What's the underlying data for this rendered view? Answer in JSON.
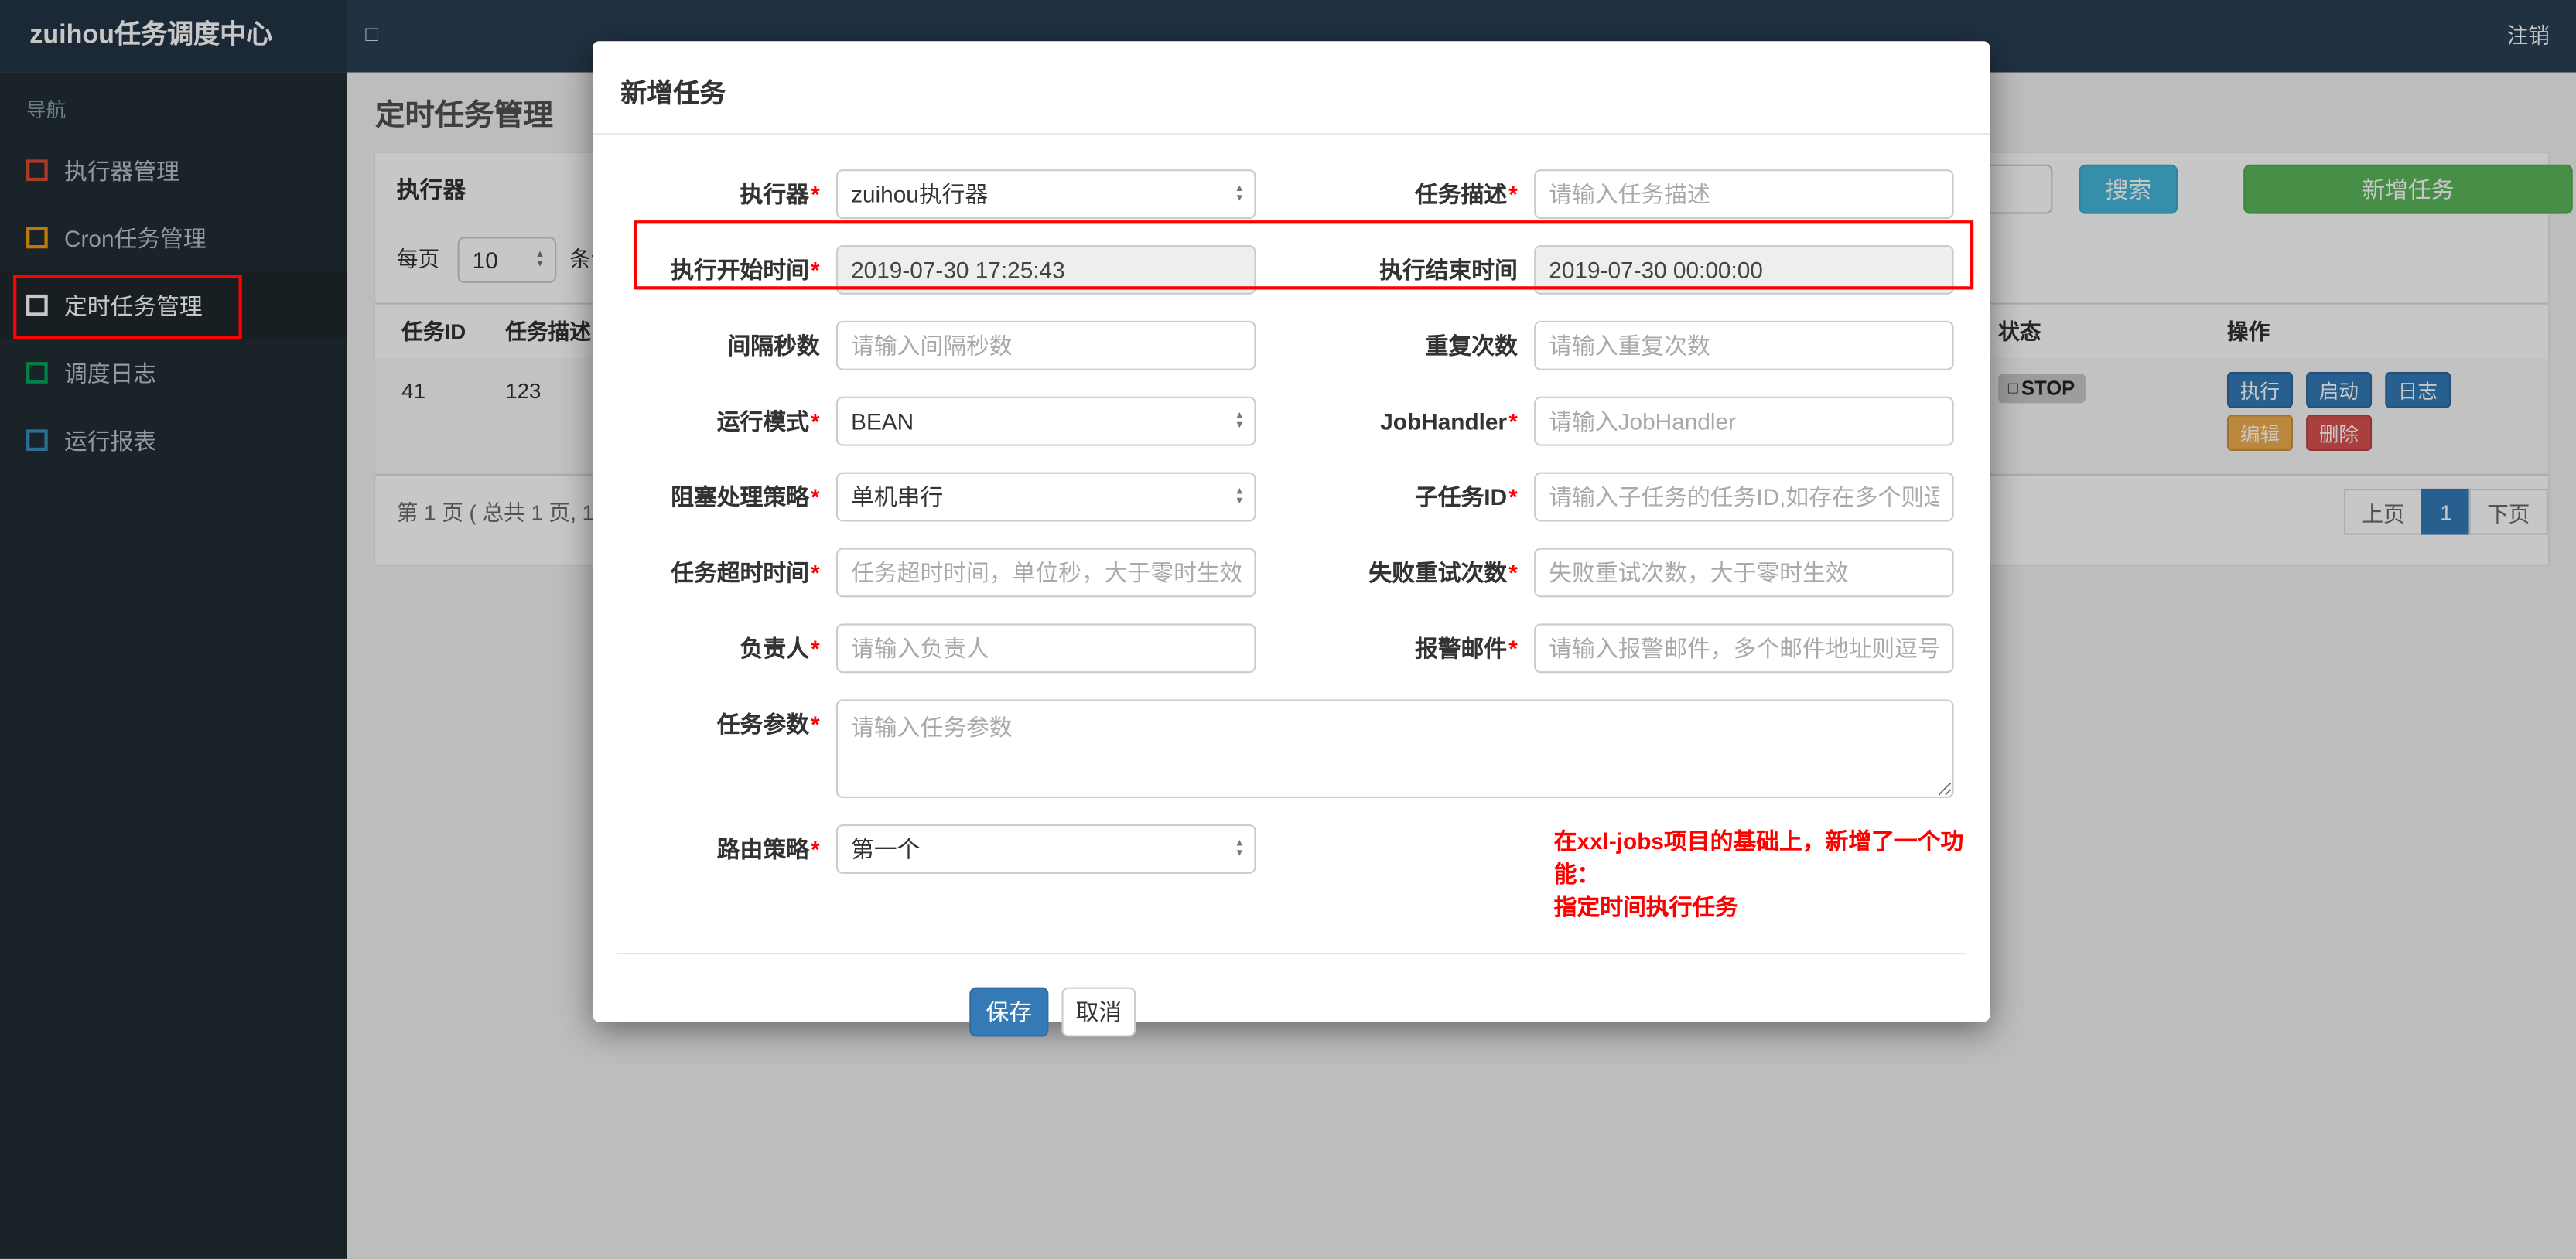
{
  "colors": {
    "topbar_bg": "#2a3f54",
    "sidebar_bg": "#222d32",
    "primary": "#337ab7",
    "success": "#5cb85c",
    "info": "#46b8da",
    "warning": "#f0ad4e",
    "danger": "#d9534f",
    "annotation": "#ff0000"
  },
  "icons": {
    "caret_up": "▲",
    "caret_down": "▼",
    "square": "□"
  },
  "topbar": {
    "brand": "zuihou任务调度中心",
    "toggle_icon": "□",
    "logout": "注销"
  },
  "sidebar": {
    "header": "导航",
    "items": [
      {
        "label": "执行器管理",
        "color": "#dd4b39"
      },
      {
        "label": "Cron任务管理",
        "color": "#f39c12"
      },
      {
        "label": "定时任务管理",
        "color": "#ffffff"
      },
      {
        "label": "调度日志",
        "color": "#00a65a"
      },
      {
        "label": "运行报表",
        "color": "#3c8dbc"
      }
    ]
  },
  "page": {
    "title": "定时任务管理",
    "filter": {
      "executor_label": "执行器",
      "search_label": "搜索",
      "add_label": "新增任务"
    },
    "page_size": {
      "prefix": "每页",
      "value": "10",
      "suffix": "条记录"
    },
    "table": {
      "headers": [
        "任务ID",
        "任务描述",
        "状态",
        "操作"
      ],
      "row": {
        "id": "41",
        "desc": "123",
        "status_icon": "□",
        "status": "STOP",
        "actions": [
          {
            "label": "执行",
            "color": "#337ab7"
          },
          {
            "label": "启动",
            "color": "#337ab7"
          },
          {
            "label": "日志",
            "color": "#337ab7"
          },
          {
            "label": "编辑",
            "color": "#f0ad4e"
          },
          {
            "label": "删除",
            "color": "#d9534f"
          }
        ]
      }
    },
    "pagination": {
      "summary": "第 1 页 ( 总共 1 页, 1",
      "prev": "上页",
      "current": "1",
      "next": "下页"
    }
  },
  "modal": {
    "title": "新增任务",
    "required_mark": "*",
    "fields": {
      "executor": {
        "label": "执行器",
        "required": true,
        "value": "zuihou执行器"
      },
      "job_desc": {
        "label": "任务描述",
        "required": true,
        "placeholder": "请输入任务描述"
      },
      "start_time": {
        "label": "执行开始时间",
        "required": true,
        "value": "2019-07-30 17:25:43"
      },
      "end_time": {
        "label": "执行结束时间",
        "required": false,
        "value": "2019-07-30 00:00:00"
      },
      "interval_seconds": {
        "label": "间隔秒数",
        "required": false,
        "placeholder": "请输入间隔秒数"
      },
      "repeat_count": {
        "label": "重复次数",
        "required": false,
        "placeholder": "请输入重复次数"
      },
      "run_mode": {
        "label": "运行模式",
        "required": true,
        "value": "BEAN"
      },
      "job_handler": {
        "label": "JobHandler",
        "required": true,
        "placeholder": "请输入JobHandler"
      },
      "block_strategy": {
        "label": "阻塞处理策略",
        "required": true,
        "value": "单机串行"
      },
      "child_job_id": {
        "label": "子任务ID",
        "required": true,
        "placeholder": "请输入子任务的任务ID,如存在多个则逗号分隔"
      },
      "timeout": {
        "label": "任务超时时间",
        "required": true,
        "placeholder": "任务超时时间，单位秒，大于零时生效"
      },
      "retry_count": {
        "label": "失败重试次数",
        "required": true,
        "placeholder": "失败重试次数，大于零时生效"
      },
      "owner": {
        "label": "负责人",
        "required": true,
        "placeholder": "请输入负责人"
      },
      "alarm_email": {
        "label": "报警邮件",
        "required": true,
        "placeholder": "请输入报警邮件，多个邮件地址则逗号分隔"
      },
      "job_params": {
        "label": "任务参数",
        "required": true,
        "placeholder": "请输入任务参数"
      },
      "route_strategy": {
        "label": "路由策略",
        "required": true,
        "value": "第一个"
      }
    },
    "note_line1": "在xxl-jobs项目的基础上，新增了一个功能：",
    "note_line2": "指定时间执行任务",
    "save_label": "保存",
    "cancel_label": "取消"
  }
}
